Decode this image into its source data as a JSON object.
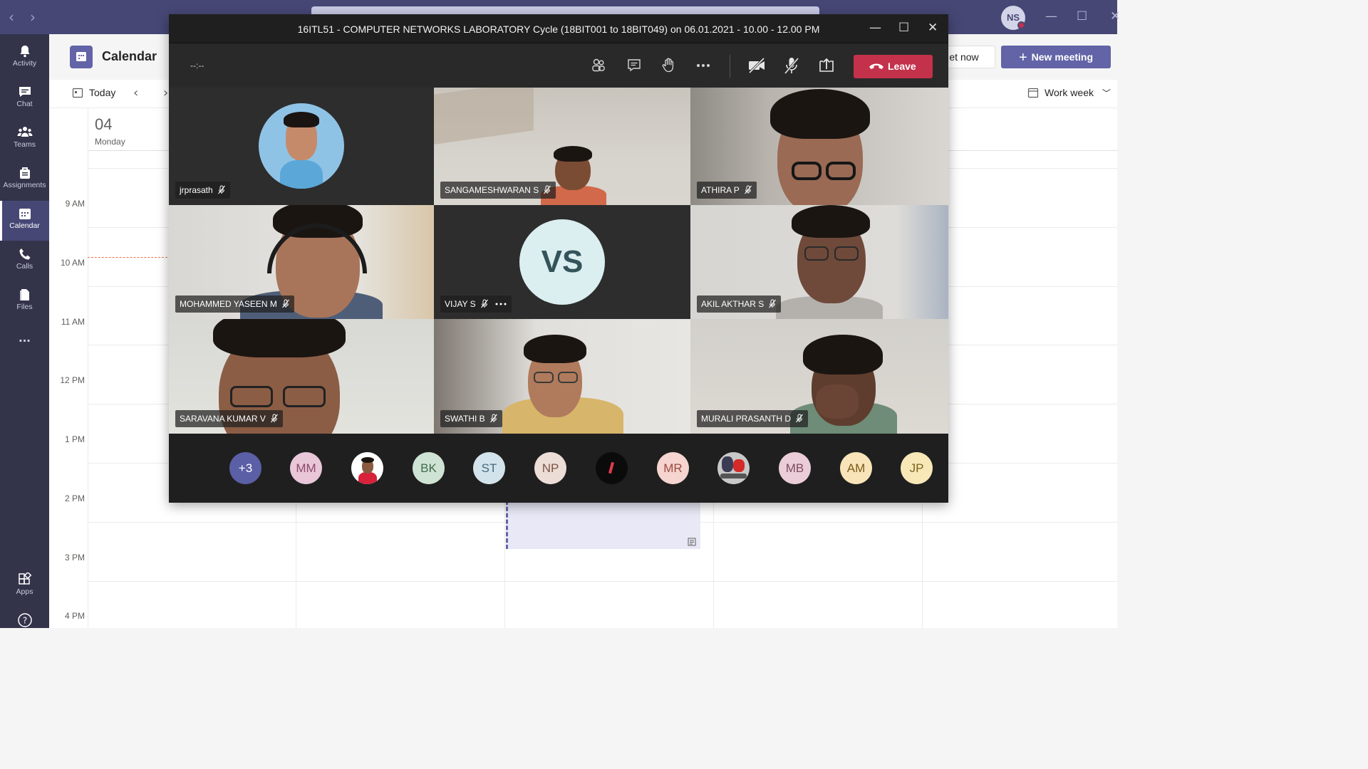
{
  "app": {
    "account_initials": "NS"
  },
  "rail": [
    {
      "label": "Activity",
      "icon": "bell-icon"
    },
    {
      "label": "Chat",
      "icon": "chat-icon"
    },
    {
      "label": "Teams",
      "icon": "teams-icon"
    },
    {
      "label": "Assignments",
      "icon": "assignments-icon"
    },
    {
      "label": "Calendar",
      "icon": "calendar-icon",
      "active": true
    },
    {
      "label": "Calls",
      "icon": "phone-icon"
    },
    {
      "label": "Files",
      "icon": "files-icon"
    },
    {
      "label": "...",
      "icon": "more-icon"
    },
    {
      "label": "Apps",
      "icon": "apps-icon"
    }
  ],
  "calendar": {
    "title": "Calendar",
    "today_label": "Today",
    "meet_now_label": "et now",
    "new_meeting_label": "New meeting",
    "view_label": "Work week",
    "day_number": "04",
    "day_name": "Monday",
    "right_day_fragment": "y",
    "hours": [
      "9 AM",
      "10 AM",
      "11 AM",
      "12 PM",
      "1 PM",
      "2 PM",
      "3 PM",
      "4 PM"
    ]
  },
  "meeting": {
    "title": "16ITL51 - COMPUTER NETWORKS LABORATORY Cycle (18BIT001 to 18BIT049) on 06.01.2021 - 10.00 - 12.00 PM",
    "timer": "--:--",
    "leave_label": "Leave",
    "participants": [
      {
        "name": "jrprasath"
      },
      {
        "name": "SANGAMESHWARAN S"
      },
      {
        "name": "ATHIRA P"
      },
      {
        "name": "MOHAMMED YASEEN M"
      },
      {
        "name": "VIJAY S",
        "initials": "VS"
      },
      {
        "name": "AKIL AKTHAR S"
      },
      {
        "name": "SARAVANA KUMAR V"
      },
      {
        "name": "SWATHI B"
      },
      {
        "name": "MURALI PRASANTH D"
      }
    ],
    "strip": [
      {
        "text": "+3",
        "bg": "#5b5fa6",
        "fg": "#ffffff"
      },
      {
        "text": "MM",
        "bg": "#e9c6d8",
        "fg": "#8a4a6b"
      },
      {
        "text": "",
        "bg": "#ffffff",
        "fg": "#000000"
      },
      {
        "text": "BK",
        "bg": "#cfe3d4",
        "fg": "#3f6b4d"
      },
      {
        "text": "ST",
        "bg": "#d3e3ec",
        "fg": "#45697d"
      },
      {
        "text": "NP",
        "bg": "#ecddd6",
        "fg": "#7b5446"
      },
      {
        "text": "",
        "bg": "#0b0b0b",
        "fg": "#ffffff"
      },
      {
        "text": "MR",
        "bg": "#f6d4d0",
        "fg": "#9c4a40"
      },
      {
        "text": "",
        "bg": "#c8c8c8",
        "fg": "#000000"
      },
      {
        "text": "MB",
        "bg": "#eacdd8",
        "fg": "#7e4a5e"
      },
      {
        "text": "AM",
        "bg": "#f8e4b8",
        "fg": "#7a5a1c"
      },
      {
        "text": "JP",
        "bg": "#f8e8b8",
        "fg": "#7a621c"
      }
    ]
  },
  "colors": {
    "teams_purple": "#464775",
    "rail": "#33344a",
    "leave_red": "#c4314b",
    "accent": "#6264a7"
  }
}
